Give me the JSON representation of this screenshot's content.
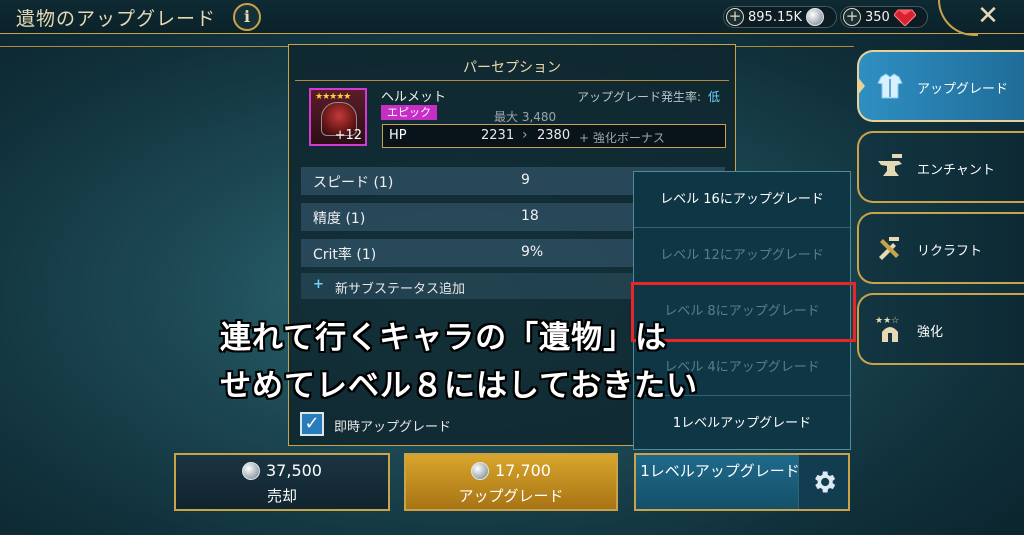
{
  "header": {
    "title": "遺物のアップグレード",
    "info_label": "i",
    "silver": "895.15K",
    "gems": "350",
    "plus_label": "+",
    "close_label": "✕"
  },
  "panel": {
    "title": "パーセプション",
    "item": {
      "name": "ヘルメット",
      "rarity": "エピック",
      "level": "+12",
      "stars": "★★★★★",
      "rate_label": "アップグレード発生率:",
      "rate_value": "低",
      "max_label": "最大 3,480"
    },
    "main_stat": {
      "label": "HP",
      "from": "2231",
      "arrow": "›",
      "to": "2380",
      "bonus": "+ 強化ボーナス"
    },
    "substats": [
      {
        "name": "スピード (1)",
        "value": "9"
      },
      {
        "name": "精度 (1)",
        "value": "18"
      },
      {
        "name": "Crit率 (1)",
        "value": "9%"
      }
    ],
    "add_substat": {
      "plus": "+",
      "label": "新サブステータス追加"
    },
    "instant_upgrade": {
      "checked": true,
      "label": "即時アップグレード",
      "check": "✓"
    }
  },
  "dropdown": {
    "items": [
      {
        "label": "レベル 16にアップグレード",
        "enabled": true
      },
      {
        "label": "レベル 12にアップグレード",
        "enabled": false
      },
      {
        "label": "レベル 8にアップグレード",
        "enabled": false
      },
      {
        "label": "レベル 4にアップグレード",
        "enabled": false
      },
      {
        "label": "1レベルアップグレード",
        "enabled": true
      }
    ]
  },
  "caption": {
    "line1": "連れて行くキャラの「遺物」は",
    "line2": "せめてレベル８にはしておきたい"
  },
  "buttons": {
    "sell": {
      "price": "37,500",
      "label": "売却"
    },
    "upgrade": {
      "price": "17,700",
      "label": "アップグレード"
    },
    "one_level": {
      "label": "1レベルアップグレード"
    }
  },
  "side_tabs": [
    {
      "label": "アップグレード",
      "active": true
    },
    {
      "label": "エンチャント",
      "active": false
    },
    {
      "label": "リクラフト",
      "active": false
    },
    {
      "label": "強化",
      "active": false
    }
  ],
  "colors": {
    "accent_gold": "#c9a34a",
    "epic_purple": "#c52fc6",
    "highlight_red": "#e8262a",
    "rate_blue": "#6fd3ff"
  },
  "icons": {
    "silver": "silver-coin-icon",
    "gem": "ruby-gem-icon",
    "settings": "gear-icon",
    "tabs": [
      "armor-icon",
      "anvil-icon",
      "tools-icon",
      "star-helmet-icon"
    ]
  }
}
